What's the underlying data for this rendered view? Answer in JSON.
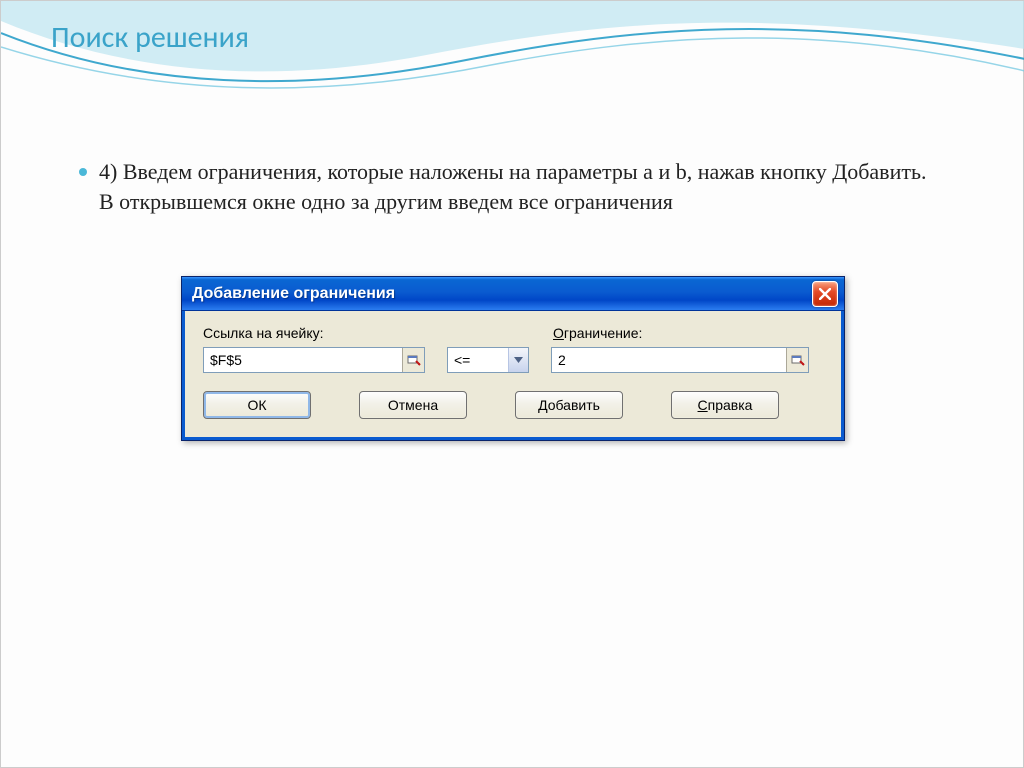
{
  "slide": {
    "title": "Поиск решения",
    "bullet_text": "4) Введем ограничения, которые наложены на параметры a и b, нажав кнопку Добавить. В открывшемся окне одно за другим введем все ограничения"
  },
  "dialog": {
    "title": "Добавление ограничения",
    "label_cell": "Ссылка на ячейку:",
    "label_constraint_prefix": "О",
    "label_constraint_rest": "граничение:",
    "cell_value": "$F$5",
    "operator": "<=",
    "constraint_value": "2",
    "buttons": {
      "ok": "ОК",
      "cancel": "Отмена",
      "add": "Добавить",
      "help_prefix": "С",
      "help_rest": "правка"
    }
  }
}
